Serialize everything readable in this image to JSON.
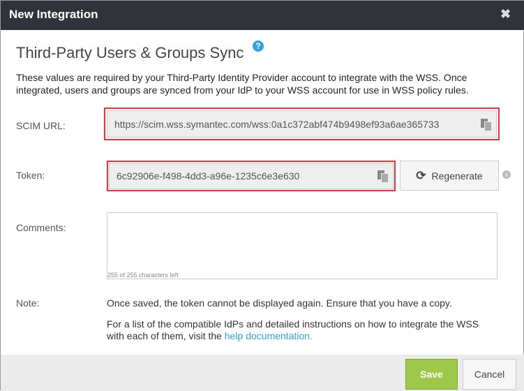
{
  "dialog": {
    "title": "New Integration",
    "close_icon": "close-icon"
  },
  "section": {
    "title": "Third-Party Users & Groups Sync",
    "help_icon": "?",
    "description": "These values are required by your Third-Party Identity Provider account to integrate with the WSS. Once integrated, users and groups are synced from your IdP to your WSS account for use in WSS policy rules."
  },
  "scim": {
    "label": "SCIM URL:",
    "value": "https://scim.wss.symantec.com/wss:0a1c372abf474b9498ef93a6ae365733"
  },
  "token": {
    "label": "Token:",
    "value": "6c92906e-f498-4dd3-a96e-1235c6e3e630",
    "regenerate_label": "Regenerate",
    "info_icon": "i"
  },
  "comments": {
    "label": "Comments:",
    "value": "",
    "chars_left": "255 of 255 characters left"
  },
  "note": {
    "label": "Note:",
    "text": "Once saved, the token cannot be displayed again. Ensure that you have a copy.",
    "help_prefix": "For a list of the compatible IdPs and detailed instructions on how to integrate the WSS with each of them, visit the ",
    "help_link": "help documentation."
  },
  "footer": {
    "save_label": "Save",
    "cancel_label": "Cancel"
  },
  "colors": {
    "header": "#31333b",
    "accent": "#2aa3e0",
    "save": "#9dc84a",
    "highlight": "#e8323c"
  }
}
